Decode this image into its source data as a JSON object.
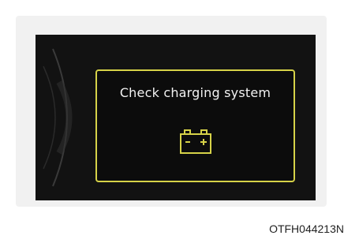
{
  "display": {
    "message": "Check charging system",
    "icon": "battery-warning-icon",
    "accent_color": "#d6d248",
    "background_color": "#121212"
  },
  "figure_code": "OTFH044213N"
}
